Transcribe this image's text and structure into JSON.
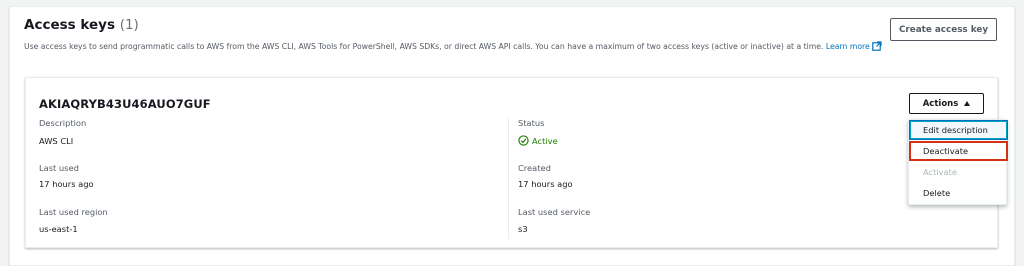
{
  "header": {
    "title": "Access keys",
    "count": "(1)",
    "description": "Use access keys to send programmatic calls to AWS from the AWS CLI, AWS Tools for PowerShell, AWS SDKs, or direct AWS API calls. You can have a maximum of two access keys (active or inactive) at a time.",
    "learn_more": "Learn more",
    "create_button": "Create access key"
  },
  "key": {
    "id": "AKIAQRYB43U46AUO7GUF",
    "actions_button": "Actions",
    "fields": {
      "description_label": "Description",
      "description_value": "AWS CLI",
      "last_used_label": "Last used",
      "last_used_value": "17 hours ago",
      "last_used_region_label": "Last used region",
      "last_used_region_value": "us-east-1",
      "status_label": "Status",
      "status_value": "Active",
      "created_label": "Created",
      "created_value": "17 hours ago",
      "last_used_service_label": "Last used service",
      "last_used_service_value": "s3"
    }
  },
  "actions_menu": {
    "items": [
      {
        "label": "Edit description"
      },
      {
        "label": "Deactivate"
      },
      {
        "label": "Activate"
      },
      {
        "label": "Delete"
      }
    ]
  },
  "colors": {
    "active_status": "#1d8102",
    "link": "#0073bb",
    "highlight_border": "#d13212"
  }
}
